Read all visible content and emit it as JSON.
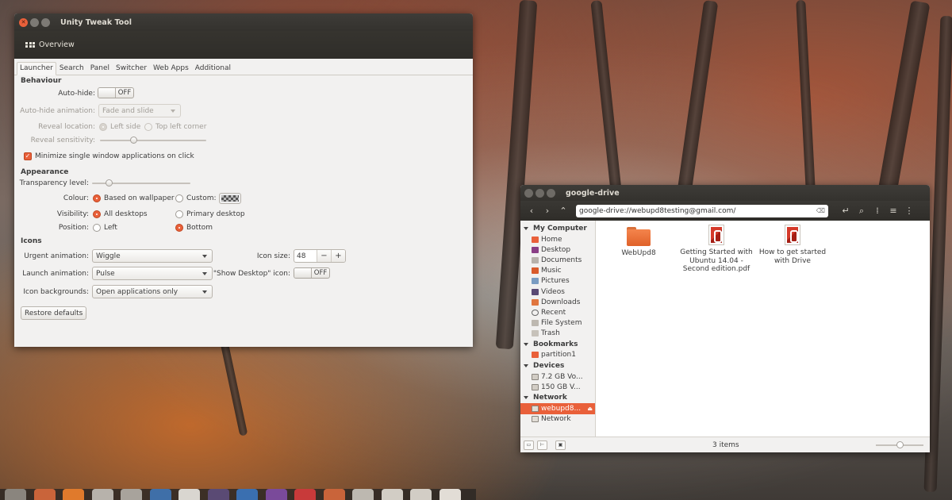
{
  "tweak_window": {
    "title": "Unity Tweak Tool",
    "overview_label": "Overview",
    "tabs": [
      "Launcher",
      "Search",
      "Panel",
      "Switcher",
      "Web Apps",
      "Additional"
    ],
    "active_tab": "Launcher",
    "behaviour": {
      "heading": "Behaviour",
      "autohide_label": "Auto-hide:",
      "autohide_state": "OFF",
      "autohide_animation_label": "Auto-hide animation:",
      "autohide_animation_value": "Fade and slide",
      "reveal_location_label": "Reveal location:",
      "reveal_left": "Left side",
      "reveal_topleft": "Top left corner",
      "reveal_sensitivity_label": "Reveal sensitivity:",
      "reveal_sensitivity_level": 0.3,
      "minimize_label": "Minimize single window applications on click",
      "minimize_checked": true
    },
    "appearance": {
      "heading": "Appearance",
      "transparency_label": "Transparency level:",
      "transparency_level": 0.15,
      "colour_label": "Colour:",
      "colour_wallpaper": "Based on wallpaper",
      "colour_custom": "Custom:",
      "visibility_label": "Visibility:",
      "visibility_all": "All desktops",
      "visibility_primary": "Primary desktop",
      "position_label": "Position:",
      "position_left": "Left",
      "position_bottom": "Bottom"
    },
    "icons": {
      "heading": "Icons",
      "urgent_label": "Urgent animation:",
      "urgent_value": "Wiggle",
      "launch_label": "Launch animation:",
      "launch_value": "Pulse",
      "backgrounds_label": "Icon backgrounds:",
      "backgrounds_value": "Open applications only",
      "icon_size_label": "Icon size:",
      "icon_size_value": "48",
      "show_desktop_label": "\"Show Desktop\" icon:",
      "show_desktop_state": "OFF"
    },
    "restore_label": "Restore defaults"
  },
  "files_window": {
    "title": "google-drive",
    "location": "google-drive://webupd8testing@gmail.com/",
    "sidebar": {
      "my_computer": "My Computer",
      "computer_items": [
        "Home",
        "Desktop",
        "Documents",
        "Music",
        "Pictures",
        "Videos",
        "Downloads",
        "Recent",
        "File System",
        "Trash"
      ],
      "bookmarks": "Bookmarks",
      "bookmark_items": [
        "partition1"
      ],
      "devices": "Devices",
      "device_items": [
        "7.2 GB Vo...",
        "150 GB V..."
      ],
      "network": "Network",
      "network_items": [
        "webupd8...",
        "Network"
      ]
    },
    "files": [
      {
        "name": "WebUpd8",
        "kind": "folder"
      },
      {
        "name": "Getting Started with Ubuntu 14.04 - Second edition.pdf",
        "kind": "pdf"
      },
      {
        "name": "How to get started with Drive",
        "kind": "pdf"
      }
    ],
    "status": "3 items",
    "zoom_level": 0.5
  },
  "colors": {
    "accent": "#e9603a",
    "titlebar": "#3a3834",
    "window_bg": "#f2f1f0"
  },
  "dock_icons": [
    "dash-icon",
    "files-icon",
    "firefox-icon",
    "software-center-icon",
    "settings-icon",
    "virtualbox-icon",
    "text-editor-icon",
    "app-icon-7",
    "app-icon-8",
    "app-icon-9",
    "app-icon-10",
    "app-icon-11",
    "app-icon-12",
    "drive-icon-1",
    "drive-icon-2",
    "drive-icon-3"
  ]
}
